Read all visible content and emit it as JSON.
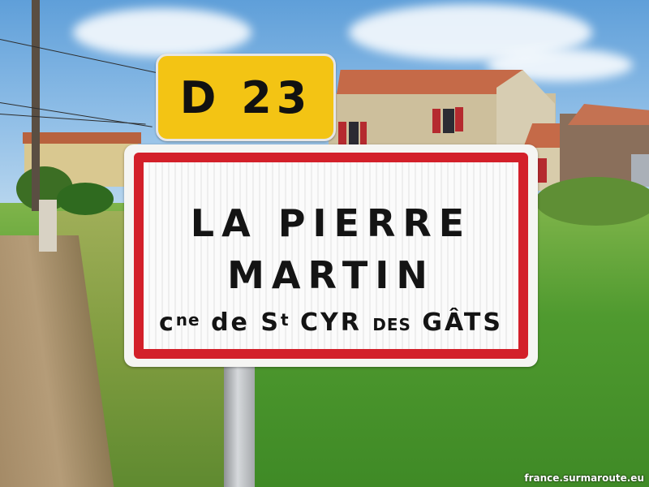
{
  "route_plate": {
    "number": "D 23",
    "background": "#f3c414"
  },
  "town_sign": {
    "line1": "LA PIERRE",
    "line2": "MARTIN",
    "line3": {
      "c": "c",
      "ne": "ne",
      "de": "de",
      "s": "S",
      "t": "t",
      "cyr": "CYR",
      "des": "DES",
      "gats": "GÂTS"
    },
    "border_color": "#d3202a"
  },
  "watermark": "france.surmaroute.eu"
}
